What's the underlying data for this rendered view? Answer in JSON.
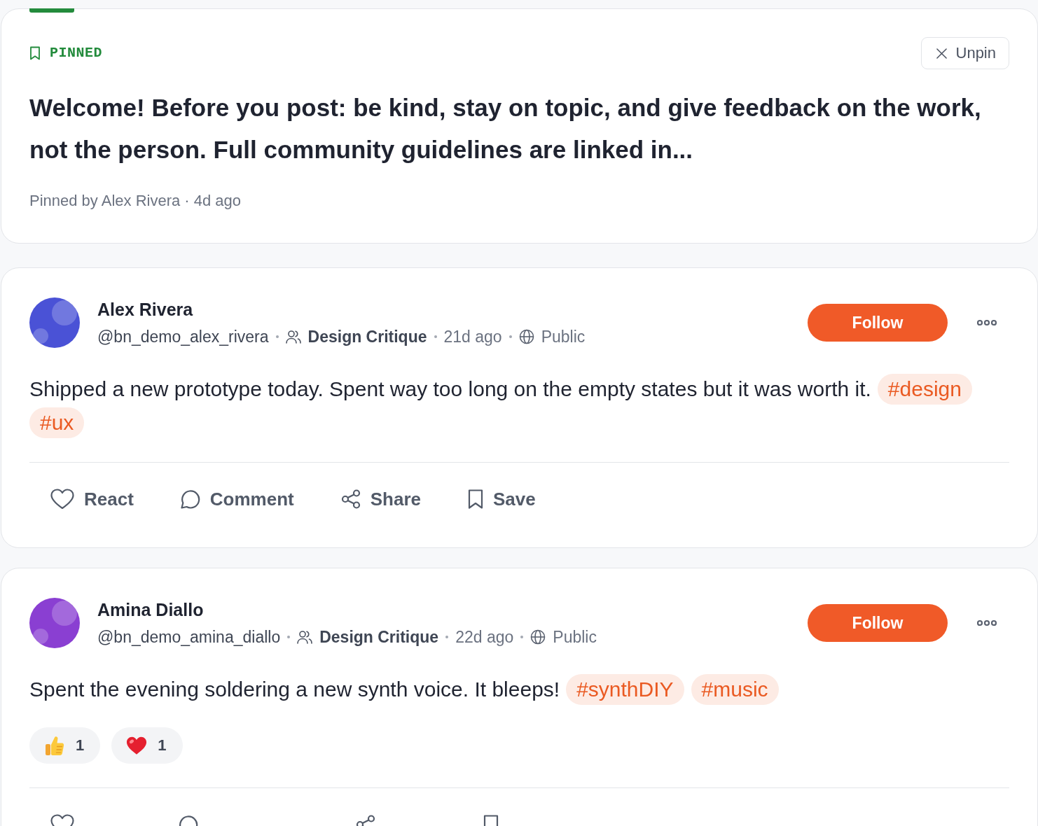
{
  "pinned": {
    "label": "PINNED",
    "unpin_button": "Unpin",
    "text": "Welcome! Before you post: be kind, stay on topic, and give feedback on the work, not the person. Full community guidelines are linked in...",
    "byline": "Pinned by Alex Rivera · 4d ago"
  },
  "posts": [
    {
      "author": "Alex Rivera",
      "color": "#4a52d6",
      "handle": "@bn_demo_alex_rivera",
      "group": "Design Critique",
      "time": "21d ago",
      "visibility": "Public",
      "follow_button": "Follow",
      "text": "Shipped a new prototype today. Spent way too long on the empty states but it was worth it.",
      "tags": [
        "#design",
        "#ux"
      ],
      "actions": [
        {
          "kind": "react",
          "label": "React"
        },
        {
          "kind": "comment",
          "label": "Comment"
        },
        {
          "kind": "share",
          "label": "Share"
        },
        {
          "kind": "save",
          "label": "Save"
        }
      ]
    },
    {
      "author": "Amina Diallo",
      "color": "#8a3fd2",
      "handle": "@bn_demo_amina_diallo",
      "group": "Design Critique",
      "time": "22d ago",
      "visibility": "Public",
      "follow_button": "Follow",
      "text": "Spent the evening soldering a new synth voice. It bleeps!",
      "tags": [
        "#synthDIY",
        "#music"
      ],
      "reactions": [
        {
          "kind": "thumbs_up",
          "count": "1"
        },
        {
          "kind": "heart",
          "count": "1"
        }
      ],
      "actions": [
        {
          "kind": "react"
        },
        {
          "kind": "comment"
        },
        {
          "kind": "share"
        },
        {
          "kind": "save"
        }
      ]
    }
  ]
}
